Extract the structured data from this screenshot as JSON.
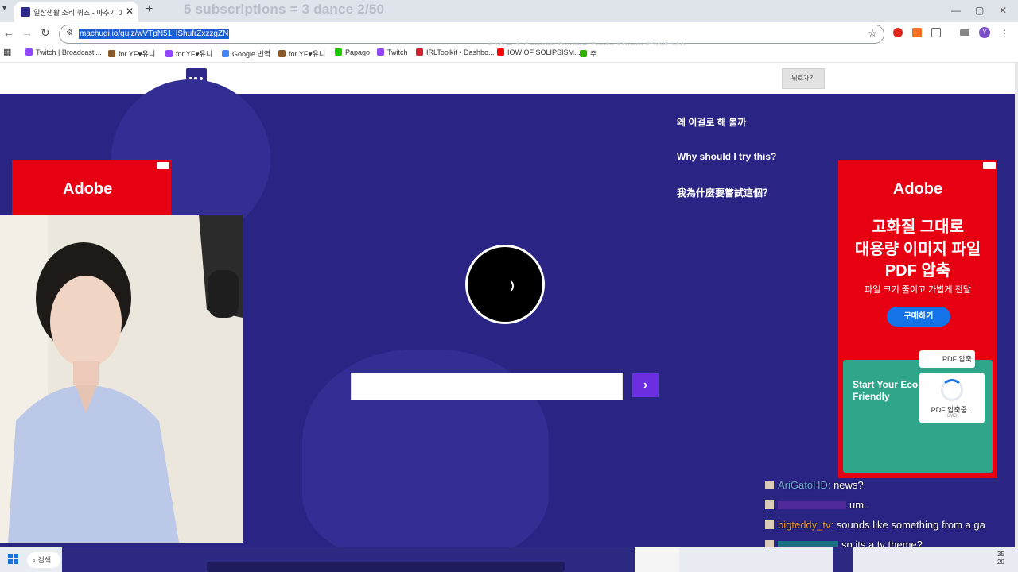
{
  "browser": {
    "tab_title": "일상생활 소리 퀴즈 - 마추기 0",
    "tab_close": "✕",
    "new_tab": "+",
    "url": "machugi.io/quiz/wVTpN51HShufrZxzzgZN",
    "profile_initial": "Y"
  },
  "stream_overlay": {
    "top_text": "5 subscriptions = 3 dance 2/50",
    "goal_text": "$10 = 1 Scratch Buying Trade Meats $30/$369"
  },
  "bookmarks": [
    {
      "label": "Twitch | Broadcasti...",
      "color": "#9146ff"
    },
    {
      "label": "for YF♥유니",
      "color": "#8a5a2b"
    },
    {
      "label": "for YF♥유니",
      "color": "#9146ff"
    },
    {
      "label": "Google 번역",
      "color": "#4285f4"
    },
    {
      "label": "for YF♥유니",
      "color": "#8a5a2b"
    },
    {
      "label": "Papago",
      "color": "#1ec800"
    },
    {
      "label": "Twitch",
      "color": "#9146ff"
    },
    {
      "label": "IRLToolkit • Dashbo...",
      "color": "#d2202f"
    },
    {
      "label": "IOW OF SOLIPSISM...",
      "color": "#ff0000"
    },
    {
      "label": "주",
      "color": "#2db400"
    }
  ],
  "page": {
    "back_button": "뒤로가기",
    "why_ko": "왜 이걸로 해 볼까",
    "why_en": "Why should I try this?",
    "why_zh": "我為什麼要嘗試這個？",
    "answer_placeholder": "",
    "submit_icon": "›"
  },
  "ads": {
    "left_brand": "Adobe",
    "right_brand": "Adobe",
    "headline_1": "고화질 그대로",
    "headline_2": "대용량 이미지 파일",
    "headline_3": "PDF 압축",
    "subline": "파일 크기 줄이고 가볍게 전달",
    "cta": "구매하기",
    "image_title": "Start Your Eco-Friendly",
    "chip_label": "PDF 압축",
    "progress_label": "PDF 압축중...",
    "progress_size": "8MB"
  },
  "chat": [
    {
      "user": "AriGatoHD:",
      "message": " news?",
      "color": "#6fa8dc"
    },
    {
      "user": "",
      "message": "um..",
      "color": "#8e44ad"
    },
    {
      "user": "bigteddy_tv:",
      "message": " sounds like something from a ga",
      "color": "#e69138"
    },
    {
      "user": "",
      "message": "so its a tv theme?",
      "color": "#16a085"
    }
  ],
  "taskbar": {
    "search_label": "검색",
    "clock_line1": "35",
    "clock_line2": "20"
  }
}
